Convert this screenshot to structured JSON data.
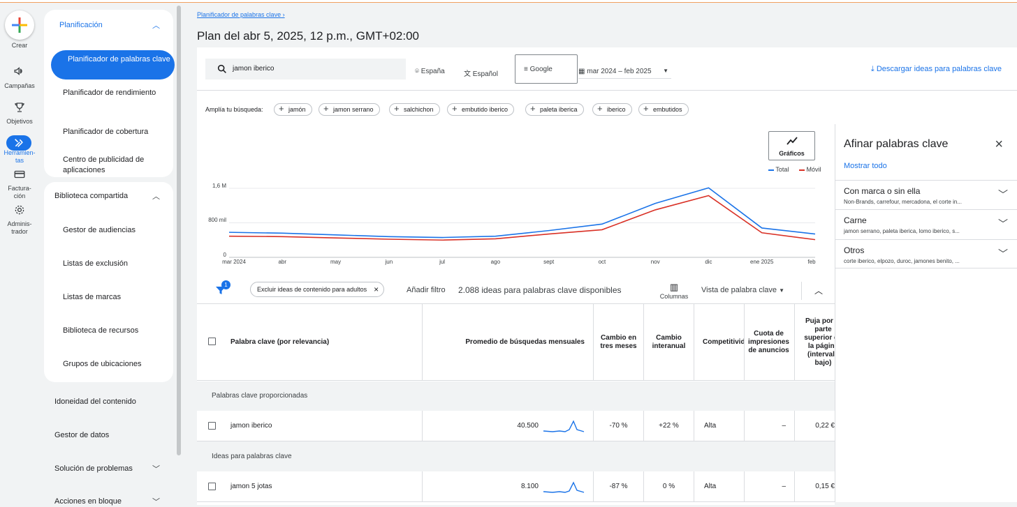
{
  "rail": {
    "create_label": "Crear",
    "items": [
      {
        "label": "Campañas",
        "icon": "megaphone-icon"
      },
      {
        "label": "Objetivos",
        "icon": "trophy-icon"
      },
      {
        "label": "Herramien-\ntas",
        "icon": "tools-icon"
      },
      {
        "label": "Factura-\nción",
        "icon": "billing-icon"
      },
      {
        "label": "Adminis-\ntrador",
        "icon": "gear-icon"
      }
    ]
  },
  "menu": {
    "planning_header": "Planificación",
    "planning_items": [
      "Planificador de palabras clave",
      "Planificador de rendimiento",
      "Planificador de cobertura",
      "Centro de publicidad de aplicaciones"
    ],
    "library_header": "Biblioteca compartida",
    "library_items": [
      "Gestor de audiencias",
      "Listas de exclusión",
      "Listas de marcas",
      "Biblioteca de recursos",
      "Grupos de ubicaciones"
    ],
    "other_items": [
      "Idoneidad del contenido",
      "Gestor de datos",
      "Solución de problemas",
      "Acciones en bloque"
    ]
  },
  "main": {
    "breadcrumb": "Planificador de palabras clave",
    "title": "Plan del abr 5, 2025, 12 p.m., GMT+02:00",
    "search_value": "jamon iberico",
    "location": "España",
    "language": "Español",
    "network": "Google",
    "date_range": "mar 2024 – feb 2025",
    "download": "Descargar ideas para palabras clave",
    "broaden_label": "Amplía tu búsqueda:",
    "chips": [
      "jamón",
      "jamon serrano",
      "salchichon",
      "embutido iberico",
      "paleta iberica",
      "iberico",
      "embutidos"
    ]
  },
  "chart_data": {
    "type": "line",
    "categories": [
      "mar 2024",
      "abr",
      "may",
      "jun",
      "jul",
      "ago",
      "sept",
      "oct",
      "nov",
      "dic",
      "ene 2025",
      "feb"
    ],
    "series": [
      {
        "name": "Total",
        "color": "#1a73e8",
        "values": [
          580000,
          560000,
          520000,
          480000,
          460000,
          490000,
          620000,
          770000,
          1250000,
          1610000,
          680000,
          540000
        ]
      },
      {
        "name": "Móvil",
        "color": "#d93025",
        "values": [
          490000,
          480000,
          450000,
          420000,
          400000,
          430000,
          540000,
          640000,
          1100000,
          1430000,
          570000,
          410000
        ]
      }
    ],
    "y_ticks": [
      "0",
      "800 mil",
      "1,6 M"
    ],
    "ylim": [
      0,
      1600000
    ],
    "legend_position": "top-right",
    "button_label": "Gráficos"
  },
  "filters": {
    "badge": "1",
    "chip_label": "Excluir ideas de contenido para adultos",
    "add_filter": "Añadir filtro",
    "count_text": "2.088 ideas para palabras clave disponibles",
    "columns_label": "Columnas",
    "view_label": "Vista de palabra clave"
  },
  "table": {
    "headers": [
      "Palabra clave (por relevancia)",
      "Promedio de búsquedas mensuales",
      "Cambio en tres meses",
      "Cambio interanual",
      "Competitividad",
      "Cuota de impresiones de anuncios",
      "Puja por la parte superior de la página (intervalo bajo)"
    ],
    "group1": "Palabras clave proporcionadas",
    "group2": "Ideas para palabras clave",
    "rows": [
      {
        "keyword": "jamon iberico",
        "searches": "40.500",
        "three_month": "-70 %",
        "yoy": "+22 %",
        "competition": "Alta",
        "share": "–",
        "bid": "0,22 €"
      },
      {
        "keyword": "jamon 5 jotas",
        "searches": "8.100",
        "three_month": "-87 %",
        "yoy": "0 %",
        "competition": "Alta",
        "share": "–",
        "bid": "0,15 €"
      }
    ]
  },
  "refine": {
    "title": "Afinar palabras clave",
    "show_all": "Mostrar todo",
    "groups": [
      {
        "title": "Con marca o sin ella",
        "subtitle": "Non-Brands, carrefour, mercadona, el corte in..."
      },
      {
        "title": "Carne",
        "subtitle": "jamon serrano, paleta iberica, lomo iberico, s..."
      },
      {
        "title": "Otros",
        "subtitle": "corte iberico, elpozo, duroc, jamones benito, ..."
      }
    ]
  }
}
